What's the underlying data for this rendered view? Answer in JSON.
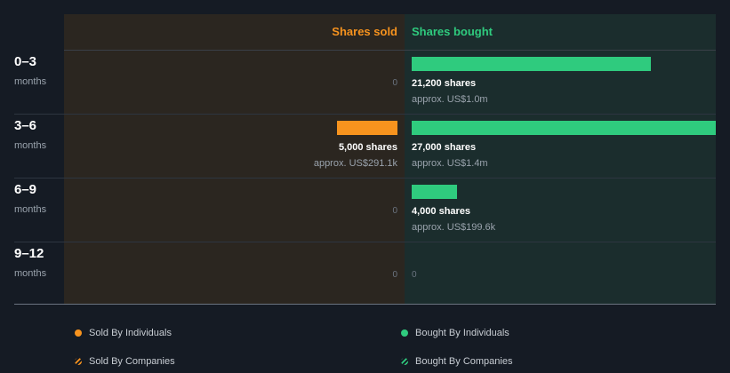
{
  "chart_data": {
    "type": "bar",
    "orientation": "horizontal-diverging",
    "categories": [
      {
        "range": "0–3",
        "unit": "months"
      },
      {
        "range": "3–6",
        "unit": "months"
      },
      {
        "range": "6–9",
        "unit": "months"
      },
      {
        "range": "9–12",
        "unit": "months"
      }
    ],
    "series": [
      {
        "name": "Shares sold",
        "color": "#f7931e",
        "values": [
          0,
          5000,
          0,
          0
        ],
        "shares_labels": [
          "",
          "5,000 shares",
          "",
          ""
        ],
        "approx_labels": [
          "",
          "approx. US$291.1k",
          "",
          ""
        ],
        "zero_labels": [
          "0",
          "",
          "0",
          "0"
        ]
      },
      {
        "name": "Shares bought",
        "color": "#2fcb7e",
        "values": [
          21200,
          27000,
          4000,
          0
        ],
        "shares_labels": [
          "21,200 shares",
          "27,000 shares",
          "4,000 shares",
          ""
        ],
        "approx_labels": [
          "approx. US$1.0m",
          "approx. US$1.4m",
          "approx. US$199.6k",
          ""
        ],
        "zero_labels": [
          "",
          "",
          "",
          "0"
        ]
      }
    ],
    "max_value": 27000,
    "legend": [
      {
        "label": "Sold By Individuals",
        "color": "#f7931e",
        "style": "solid"
      },
      {
        "label": "Bought By Individuals",
        "color": "#2fcb7e",
        "style": "solid"
      },
      {
        "label": "Sold By Companies",
        "color": "#f7931e",
        "style": "hatched"
      },
      {
        "label": "Bought By Companies",
        "color": "#2fcb7e",
        "style": "hatched"
      }
    ],
    "legend_position": "bottom"
  }
}
